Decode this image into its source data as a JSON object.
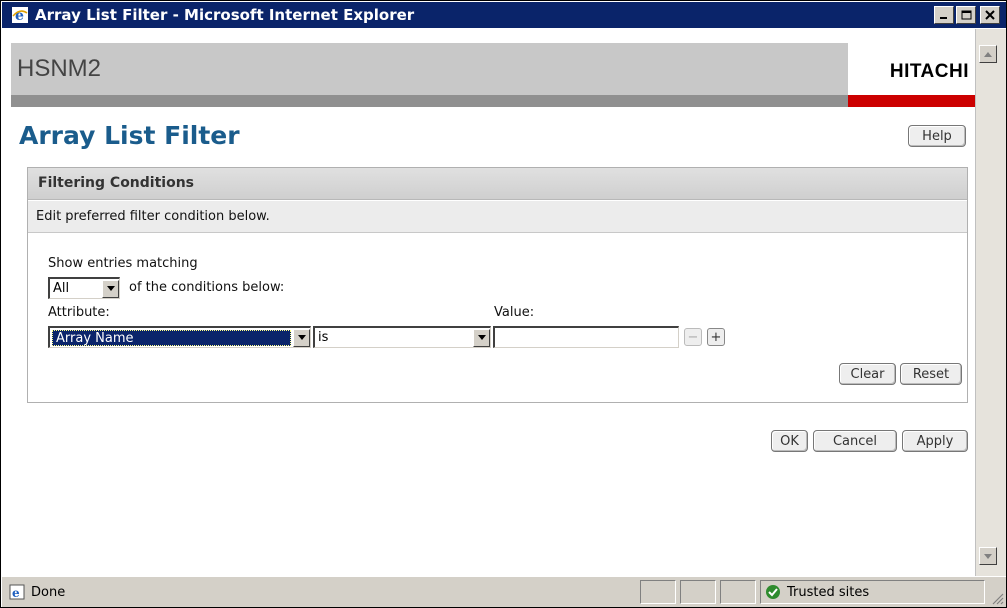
{
  "window": {
    "title": "Array List Filter - Microsoft Internet Explorer",
    "minimize": "_",
    "maximize": "□",
    "close": "✕"
  },
  "header": {
    "product": "HSNM2",
    "logo": "HITACHI"
  },
  "page": {
    "title": "Array List Filter",
    "help_label": "Help"
  },
  "panel": {
    "header": "Filtering Conditions",
    "instruction": "Edit preferred filter condition below.",
    "show_label": "Show entries matching",
    "match_select": "All",
    "match_suffix": "of the conditions below:",
    "attribute_label": "Attribute:",
    "value_label": "Value:",
    "attribute_select": "Array Name",
    "operator_select": "is",
    "value_input": "",
    "remove_label": "−",
    "add_label": "+",
    "clear_label": "Clear",
    "reset_label": "Reset"
  },
  "actions": {
    "ok_label": "OK",
    "cancel_label": "Cancel",
    "apply_label": "Apply"
  },
  "status": {
    "text": "Done",
    "zone": "Trusted sites"
  },
  "icons": {
    "browser": "ie-icon",
    "zone": "trusted-check-icon"
  }
}
